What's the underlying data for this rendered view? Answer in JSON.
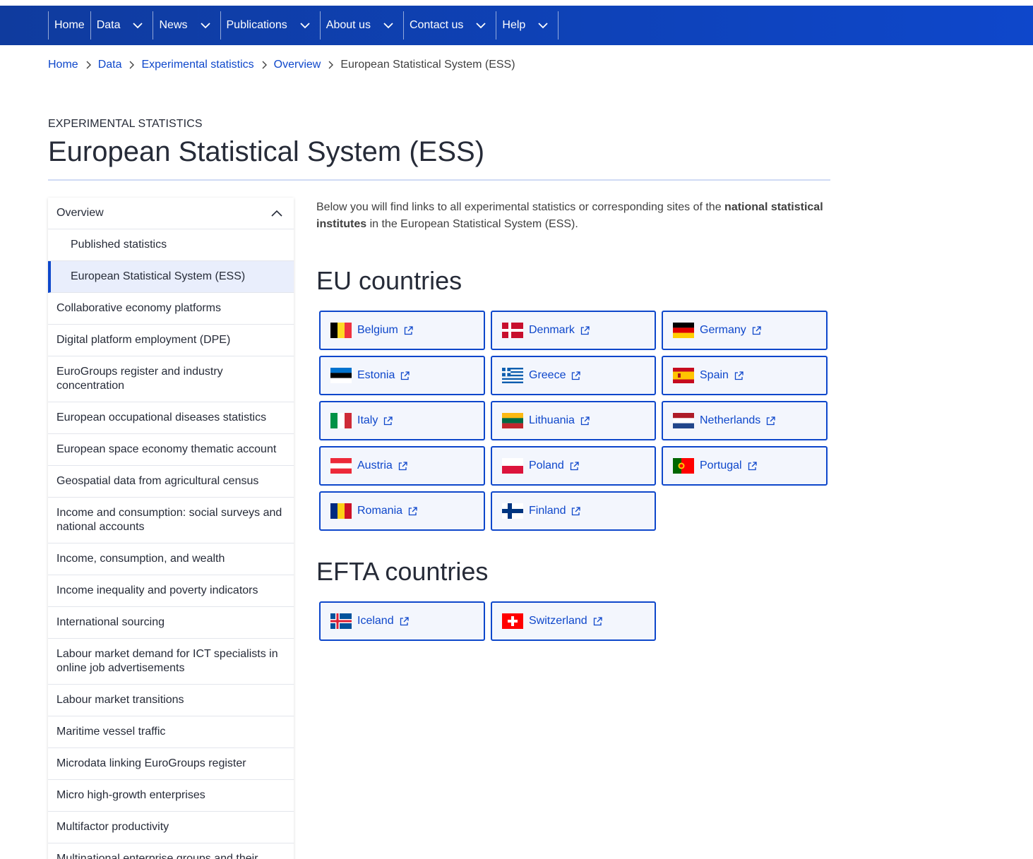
{
  "nav": {
    "items": [
      {
        "label": "Home"
      },
      {
        "label": "Data"
      },
      {
        "label": "News"
      },
      {
        "label": "Publications"
      },
      {
        "label": "About us"
      },
      {
        "label": "Contact us"
      },
      {
        "label": "Help"
      }
    ]
  },
  "breadcrumb": {
    "links": [
      "Home",
      "Data",
      "Experimental statistics",
      "Overview"
    ],
    "current": "European Statistical System (ESS)"
  },
  "page": {
    "kicker": "EXPERIMENTAL STATISTICS",
    "title": "European Statistical System (ESS)"
  },
  "sidenav": {
    "overview": "Overview",
    "published": "Published statistics",
    "active": "European Statistical System (ESS)",
    "items": [
      "Collaborative economy platforms",
      "Digital platform employment (DPE)",
      "EuroGroups register and industry concentration",
      "European occupational diseases statistics",
      "European space economy thematic account",
      "Geospatial data from agricultural census",
      "Income and consumption: social surveys and national accounts",
      "Income, consumption, and wealth",
      "Income inequality and poverty indicators",
      "International sourcing",
      "Labour market demand for ICT specialists in online job advertisements",
      "Labour market transitions",
      "Maritime vessel traffic",
      "Microdata linking EuroGroups register",
      "Micro high-growth enterprises",
      "Multifactor productivity",
      "Multinational enterprise groups and their"
    ]
  },
  "intro": {
    "before": "Below you will find links to all experimental statistics or corresponding sites of the ",
    "bold": "national statistical institutes",
    "after": " in the European Statistical System (ESS)."
  },
  "eu": {
    "title": "EU countries",
    "countries": [
      "Belgium",
      "Denmark",
      "Germany",
      "Estonia",
      "Greece",
      "Spain",
      "Italy",
      "Lithuania",
      "Netherlands",
      "Austria",
      "Poland",
      "Portugal",
      "Romania",
      "Finland"
    ]
  },
  "efta": {
    "title": "EFTA countries",
    "countries": [
      "Iceland",
      "Switzerland"
    ]
  },
  "colors": {
    "nav_bg": "#0e47cb",
    "link": "#0e47cb",
    "card_bg": "#f3f6fd",
    "active_bg": "#e9eefc"
  },
  "icons": {
    "chevron": "chevron-down-icon",
    "external": "external-link-icon"
  }
}
